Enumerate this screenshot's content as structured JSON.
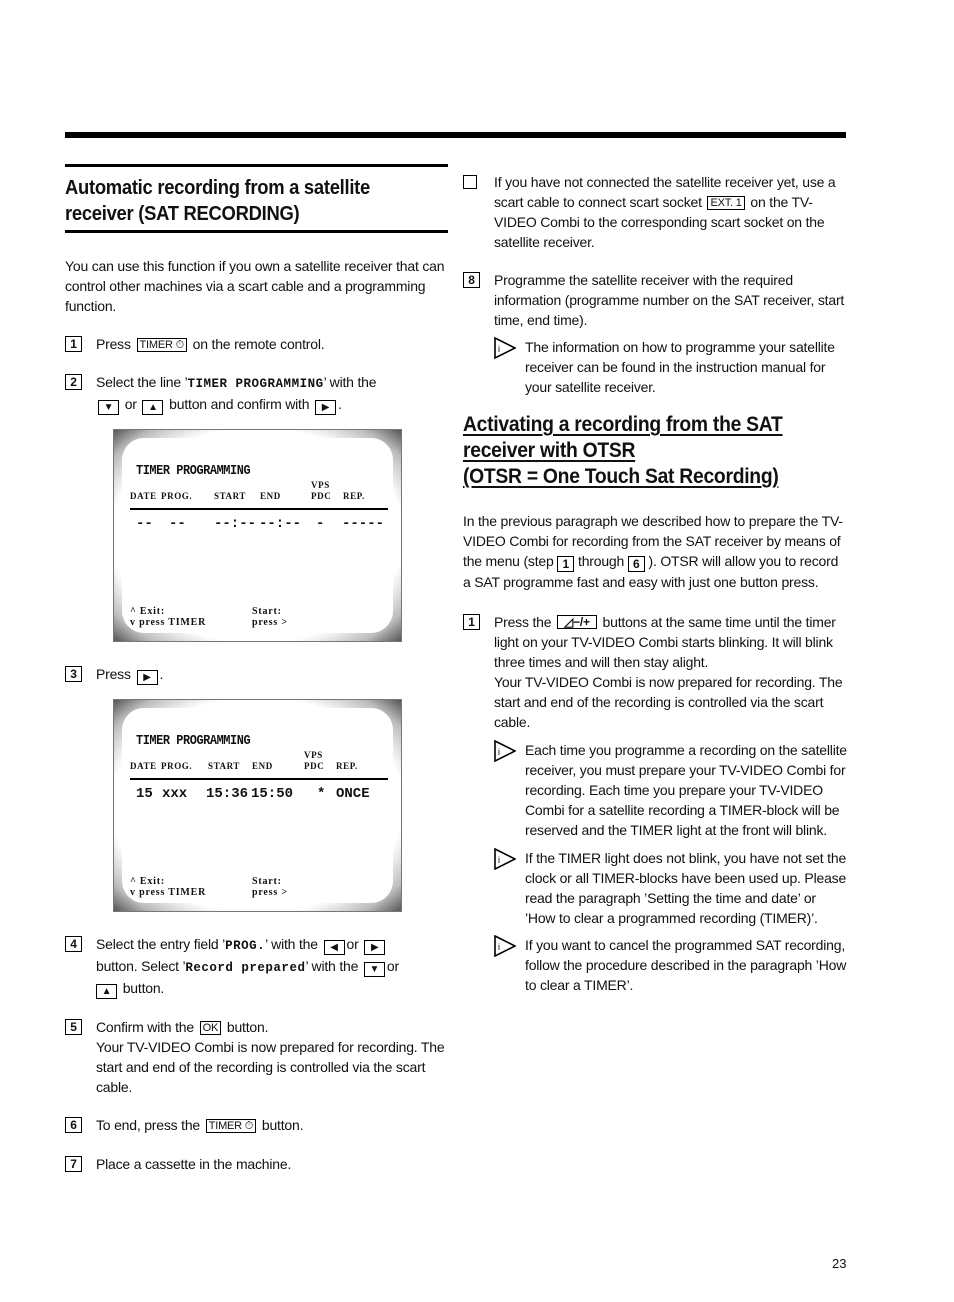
{
  "page_number": "23",
  "left": {
    "title_line1": "Automatic recording from a satellite",
    "title_line2": "receiver (SAT RECORDING)",
    "intro": "You can use this function if you own a satellite receiver that can control other machines via a scart cable and a programming function.",
    "steps": [
      {
        "num": "1",
        "pre": "Press",
        "key": "TIMER ⏱",
        "post": "on the remote control."
      },
      {
        "num": "2",
        "pre": "Select the line ’",
        "mono": "TIMER PROGRAMMING",
        "mid": "’ with the",
        "k1": "▼",
        "or": "or",
        "k2": "▲",
        "mid2": "button and confirm with",
        "k3": "▶",
        "end": "."
      },
      {
        "num": "3",
        "pre": "Press",
        "k1": "▶",
        "end": "."
      },
      {
        "num": "4",
        "pre": "Select the entry field ’",
        "mono": "PROG.",
        "mid": "’ with the",
        "k1": "◀",
        "or": "or",
        "k2": "▶",
        "line2a": "button. Select ’",
        "mono2": "Record prepared",
        "line2b": "’ with the",
        "k3": "▼",
        "or2": "or",
        "k4": "▲",
        "end": "button."
      },
      {
        "num": "5",
        "pre": "Confirm with the",
        "key": "OK",
        "post": "button.",
        "extra": "Your TV-VIDEO Combi is now prepared for recording. The start and end of the recording is controlled via the scart cable."
      },
      {
        "num": "6",
        "pre": "To end, press the",
        "key": "TIMER ⏱",
        "post": "button."
      },
      {
        "num": "7",
        "text": "Place a cassette in the machine."
      }
    ],
    "screen1": {
      "title": "TIMER PROGRAMMING",
      "headers": {
        "date": "DATE",
        "prog": "PROG.",
        "start": "START",
        "end": "END",
        "vps": "VPS",
        "pdc": "PDC",
        "rep": "REP."
      },
      "row": {
        "date": "--",
        "prog": "--",
        "start": "--:--",
        "end": "--:--",
        "vps": "-",
        "rep": "-----"
      },
      "foot": {
        "l1": "^ Exit:",
        "l2": "v press TIMER",
        "r1": "Start:",
        "r2": "press >"
      }
    },
    "screen2": {
      "title": "TIMER PROGRAMMING",
      "headers": {
        "date": "DATE",
        "prog": "PROG.",
        "start": "START",
        "end": "END",
        "vps": "VPS",
        "pdc": "PDC",
        "rep": "REP."
      },
      "row": {
        "date": "15",
        "prog": "xxx",
        "start": "15:36",
        "end": "15:50",
        "vps": "*",
        "rep": "ONCE"
      },
      "foot": {
        "l1": "^ Exit:",
        "l2": "v press TIMER",
        "r1": "Start:",
        "r2": "press >"
      }
    }
  },
  "right": {
    "check_item": {
      "pre": "If you have not connected the satellite receiver yet, use a scart cable to connect scart socket",
      "key": "EXT. 1",
      "post": "on the TV-VIDEO Combi to the corresponding scart socket on the satellite receiver."
    },
    "step8": {
      "num": "8",
      "text": "Programme the satellite receiver with the required information (programme number on the SAT receiver, start time, end time)."
    },
    "note8": "The information on how to programme your satellite receiver can be found in the instruction manual for your satellite receiver.",
    "title_line1": "Activating a recording from the SAT",
    "title_line2": "receiver with OTSR",
    "title_line3": "(OTSR = One Touch Sat Recording)",
    "intro_pre": "In the previous paragraph we described how to prepare the TV-VIDEO Combi for recording from the SAT receiver by means of the menu (step",
    "intro_n1": "1",
    "intro_mid": "through",
    "intro_n2": "6",
    "intro_post": "). OTSR will allow you to record a SAT programme fast and easy with just one button press.",
    "otsr_step": {
      "num": "1",
      "pre": "Press the",
      "key": "◿−/+",
      "post": "buttons at the same time until the timer light on your TV-VIDEO Combi starts blinking. It will blink three times and will then stay alight.",
      "extra": "Your TV-VIDEO Combi is now prepared for recording. The start and end of the recording is controlled via the scart cable."
    },
    "notes": [
      "Each time you programme a recording on the satellite receiver, you must prepare your TV-VIDEO Combi for recording. Each time you prepare your TV-VIDEO Combi for a satellite recording a TIMER-block will be reserved and the TIMER light at the front will blink.",
      "If the TIMER light does not blink, you have not set the clock or all TIMER-blocks have been used up. Please read the paragraph ’Setting the time and date’ or ’How to clear a programmed recording (TIMER)’.",
      "If you want to cancel the programmed SAT recording, follow the procedure described in the paragraph ’How to clear a TIMER’."
    ]
  }
}
